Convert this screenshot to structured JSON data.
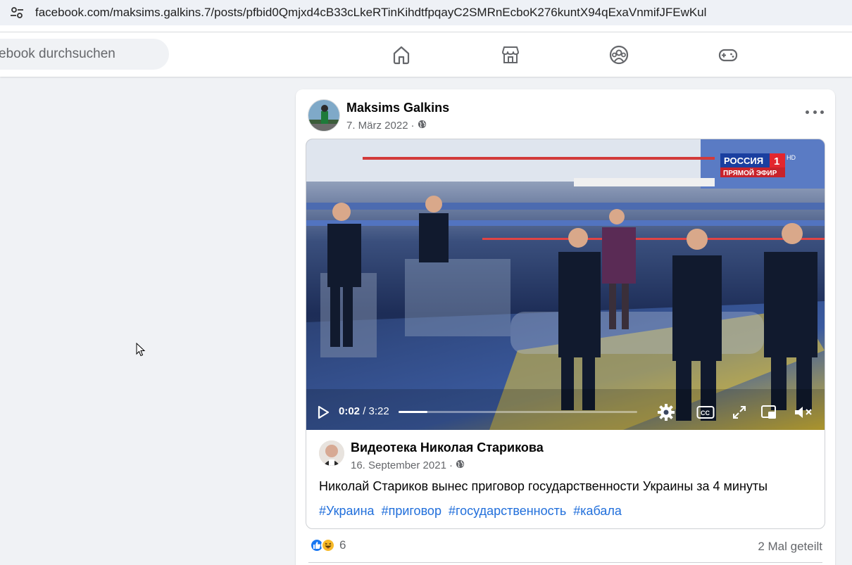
{
  "browser": {
    "url": "facebook.com/maksims.galkins.7/posts/pfbid0Qmjxd4cB33cLkeRTinKihdtfpqayC2SMRnEcboK276kuntX94qExaVnmifJFEwKul",
    "site_info_icon": "tune-icon"
  },
  "header": {
    "search_placeholder": "ebook durchsuchen",
    "nav": [
      "home-icon",
      "marketplace-icon",
      "groups-icon",
      "gaming-icon"
    ]
  },
  "post": {
    "author": "Maksims Galkins",
    "date": "7. März 2022",
    "separator": "·",
    "privacy_icon": "globe-icon",
    "more_icon": "more-icon",
    "video": {
      "current_time": "0:02",
      "duration": "/ 3:22",
      "progress": 0.12,
      "channel_logo_top": "РОССИЯ",
      "channel_logo_num": "1",
      "channel_logo_hd": "HD",
      "channel_logo_bottom": "ПРЯМОЙ ЭФИР"
    },
    "shared": {
      "author": "Видеотека Николая Старикова",
      "date": "16. September 2021",
      "separator": "·",
      "text": "Николай Стариков вынес приговор государственности Украины за 4 минуты",
      "tags": [
        "#Украина",
        "#приговор",
        "#государственность",
        "#кабала"
      ]
    },
    "reactions": {
      "count": "6",
      "types": [
        "like",
        "haha"
      ]
    },
    "shares": "2 Mal geteilt"
  },
  "colors": {
    "accent": "#216fdb",
    "like": "#1877f2",
    "haha": "#f7b928",
    "background": "#f0f2f5"
  }
}
